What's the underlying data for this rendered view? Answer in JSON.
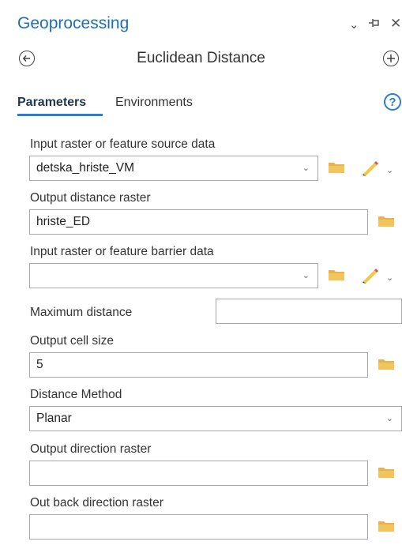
{
  "panel": {
    "title": "Geoprocessing",
    "header_icons": [
      "chevron-down-icon",
      "pin-icon",
      "close-icon"
    ],
    "back_icon": "back-arrow-icon",
    "add_icon": "add-icon",
    "tool_title": "Euclidean Distance",
    "tabs": [
      "Parameters",
      "Environments"
    ],
    "active_tab": "Parameters",
    "help_label": "?"
  },
  "params": {
    "input_source": {
      "label": "Input raster or feature source data",
      "value": "detska_hriste_VM"
    },
    "output_distance": {
      "label": "Output distance raster",
      "value": "hriste_ED"
    },
    "barrier": {
      "label": "Input raster or feature barrier data",
      "value": ""
    },
    "max_distance": {
      "label": "Maximum distance",
      "value": ""
    },
    "cell_size": {
      "label": "Output cell size",
      "value": "5"
    },
    "distance_method": {
      "label": "Distance Method",
      "value": "Planar"
    },
    "output_direction": {
      "label": "Output direction raster",
      "value": ""
    },
    "out_back_direction": {
      "label": "Out back direction raster",
      "value": ""
    }
  },
  "colors": {
    "accent": "#2e7bd0",
    "title": "#1f6fb4",
    "folder": "#e8b44a"
  }
}
